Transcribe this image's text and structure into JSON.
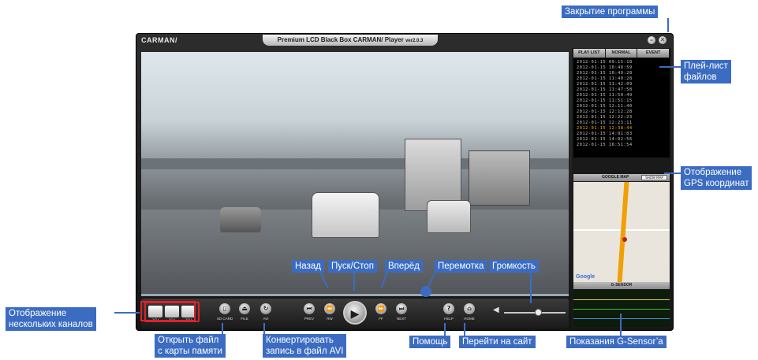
{
  "app": {
    "logo": "CARMAN/",
    "title": "Premium LCD Black Box CARMAN/ Player",
    "version": "ver2.0.3",
    "minimize_label": "–",
    "close_label": "✕"
  },
  "playlist": {
    "tabs": [
      "PLAY LIST",
      "NORMAL",
      "EVENT"
    ],
    "items": [
      "2012-01-15 09:15:18",
      "2012-01-15 10:48:59",
      "2012-01-15 10:49:28",
      "2012-01-15 11:40:28",
      "2012-01-15 11:42:09",
      "2012-01-15 11:47:58",
      "2012-01-15 11:50:49",
      "2012-01-15 11:51:15",
      "2012-01-15 12:11:40",
      "2012-01-15 12:12:28",
      "2012-01-15 12:22:23",
      "2012-01-15 12:23:11",
      "2012-01-15 12:38:44",
      "2012-01-15 14:01:03",
      "2012-01-15 14:02:56",
      "2012-01-15 16:51:54"
    ],
    "highlighted_index": 12
  },
  "map": {
    "title": "GOOGLE MAP",
    "button_label": "SHOW MAP",
    "google_logo": "Google"
  },
  "gsensor": {
    "title": "G-SENSOR"
  },
  "controls": {
    "channels": [
      "1CH",
      "2CH",
      "3CH"
    ],
    "sd_card": "SD CARD",
    "file": "FILE",
    "avi": "AVI",
    "prev": "PREV",
    "rw": "RW",
    "play": "▶",
    "ff": "FF",
    "next": "NEXT",
    "help": "HELP",
    "home": "HOME",
    "volume_level": 0.55
  },
  "callouts": {
    "close_program": "Закрытие программы",
    "playlist": "Плей-лист\nфайлов",
    "gps": "Отображение\nGPS координат",
    "channels": "Отображение\nнескольких каналов",
    "open_sd": "Открыть файл\nс карты памяти",
    "convert_avi": "Конвертировать\nзапись в файл AVI",
    "back": "Назад",
    "play_stop": "Пуск/Стоп",
    "forward": "Вперёд",
    "seek": "Перемотка",
    "volume": "Громкость",
    "help": "Помощь",
    "website": "Перейти на сайт",
    "gsensor": "Показания G-Sensor’a"
  },
  "colors": {
    "callout_bg": "#3b6cc2",
    "highlight_frame": "#e0202a",
    "playlist_highlight": "#ffb000"
  }
}
